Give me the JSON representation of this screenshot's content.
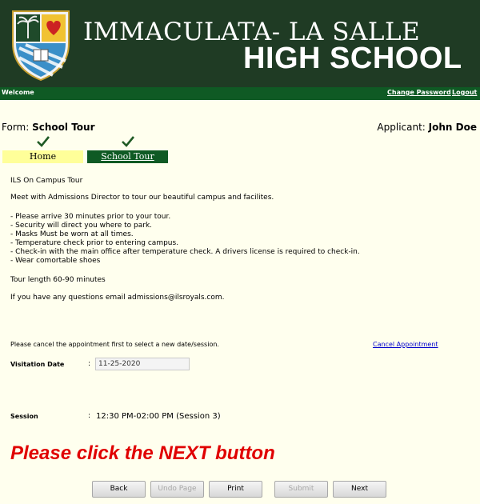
{
  "header": {
    "school_line1": "IMMACULATA- LA SALLE",
    "school_line2": "HIGH SCHOOL"
  },
  "navbar": {
    "welcome": "Welcome",
    "change_password": "Change Password",
    "logout": "Logout"
  },
  "form": {
    "label": "Form:",
    "name": "School Tour",
    "applicant_label": "Applicant:",
    "applicant_name": "John Doe"
  },
  "tabs": [
    {
      "label": "Home",
      "completed": true,
      "active": false
    },
    {
      "label": "School Tour",
      "completed": true,
      "active": true
    }
  ],
  "content": {
    "heading": "ILS On Campus Tour",
    "intro": "Meet with Admissions Director to tour our beautiful campus and facilites.",
    "bullets": [
      "- Please arrive 30 minutes prior to your tour.",
      "- Security will direct you where to park.",
      "- Masks Must be worn at all times.",
      "- Temperature check prior to entering campus.",
      "- Check-in with the main office after temperature check. A drivers license is required to check-in.",
      "- Wear comortable shoes"
    ],
    "tour_length": "Tour length 60-90 minutes",
    "contact": "If you have any questions email admissions@ilsroyals.com."
  },
  "appointment": {
    "cancel_note": "Please cancel the appointment first to select a new date/session.",
    "cancel_link": "Cancel Appointment",
    "visitation_label": "Visitation Date",
    "visitation_value": "11-25-2020",
    "session_label": "Session",
    "session_value": "12:30 PM-02:00 PM (Session 3)",
    "colon": ":"
  },
  "notice": "Please click the NEXT button",
  "buttons": {
    "back": "Back",
    "undo_page": "Undo Page",
    "print": "Print",
    "submit": "Submit",
    "next": "Next"
  },
  "colors": {
    "header_bg": "#1f3b24",
    "nav_bg": "#0f5a24",
    "page_bg": "#ffffee",
    "notice": "#e00000",
    "home_tab": "#ffff99"
  }
}
